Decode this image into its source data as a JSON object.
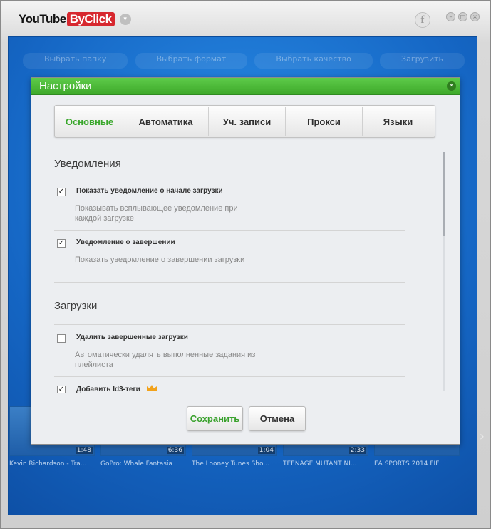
{
  "app": {
    "logo_part1": "YouTube",
    "logo_part2": "ByClick",
    "facebook_glyph": "f"
  },
  "background": {
    "steps": [
      "Выбрать папку",
      "Выбрать формат",
      "Выбрать качество",
      "Загрузить"
    ],
    "videos": [
      {
        "title": "Kevin Richardson - Tra...",
        "duration": "1:48"
      },
      {
        "title": "GoPro: Whale Fantasia",
        "duration": "6:36"
      },
      {
        "title": "The Looney Tunes Sho...",
        "duration": "1:04"
      },
      {
        "title": "TEENAGE MUTANT NI...",
        "duration": "2:33"
      },
      {
        "title": "EA SPORTS 2014 FIF",
        "duration": ""
      }
    ]
  },
  "dialog": {
    "title": "Настройки",
    "tabs": [
      {
        "label": "Основные",
        "active": true
      },
      {
        "label": "Автоматика",
        "active": false
      },
      {
        "label": "Уч. записи",
        "active": false
      },
      {
        "label": "Прокси",
        "active": false
      },
      {
        "label": "Языки",
        "active": false
      }
    ],
    "sections": [
      {
        "title": "Уведомления",
        "items": [
          {
            "label": "Показать уведомление о начале загрузки",
            "desc": "Показывать всплывающее уведомление при каждой загрузке",
            "checked": true
          },
          {
            "label": "Уведомление о завершении",
            "desc": "Показать уведомление о завершении загрузки",
            "checked": true
          }
        ]
      },
      {
        "title": "Загрузки",
        "items": [
          {
            "label": "Удалить завершенные загрузки",
            "desc": "Автоматически удалять выполненные задания из плейлиста",
            "checked": false
          },
          {
            "label": "Добавить Id3-теги",
            "desc": "",
            "checked": true,
            "premium": true
          }
        ]
      }
    ],
    "buttons": {
      "save": "Сохранить",
      "cancel": "Отмена"
    }
  },
  "colors": {
    "accent_green": "#3ea92a",
    "background_blue": "#1566c4"
  },
  "icons": {
    "dialog_close": "close-icon",
    "premium": "crown-icon"
  }
}
